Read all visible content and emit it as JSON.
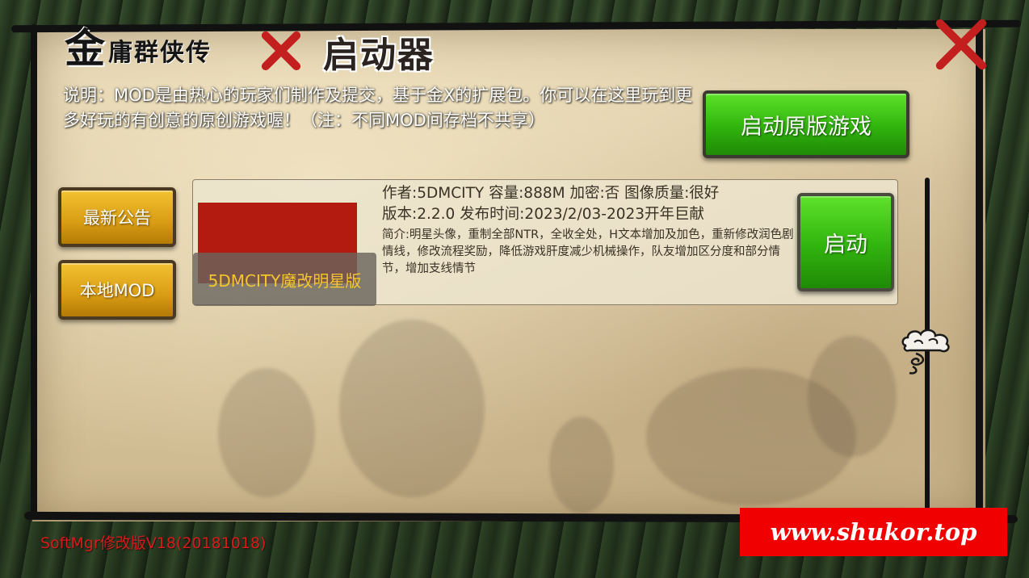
{
  "header": {
    "logo_big_char": "金",
    "logo_rest": "庸群侠传",
    "launcher_title": "启动器"
  },
  "description": "说明：MOD是由热心的玩家们制作及提交，基于金X的扩展包。你可以在这里玩到更多好玩的有创意的原创游戏喔！（注：不同MOD间存档不共享）",
  "buttons": {
    "launch_original": "启动原版游戏",
    "latest_news": "最新公告",
    "local_mod": "本地MOD"
  },
  "mod": {
    "name": "5DMCITY魔改明星版",
    "author_line": "作者:5DMCITY  容量:888M  加密:否  图像质量:很好",
    "version_line": "版本:2.2.0  发布时间:2023/2/03-2023开年巨献",
    "intro": "简介:明星头像，重制全部NTR，全收全处，H文本增加及加色，重新修改润色剧情线，修改流程奖励，降低游戏肝度减少机械操作，队友增加区分度和部分情节，增加支线情节",
    "launch_label": "启动",
    "thumb_color": "#b31b10"
  },
  "footer": {
    "version": "SoftMgr修改版V18(20181018)",
    "watermark": "www.shukor.top"
  },
  "colors": {
    "accent_green": "#31b30e",
    "accent_yellow": "#d99c14",
    "x_red": "#c41f1f",
    "mod_name": "#f3c62c",
    "version_red": "#d61b1b"
  },
  "icons": [
    "x-mark-icon",
    "cloud-icon"
  ]
}
